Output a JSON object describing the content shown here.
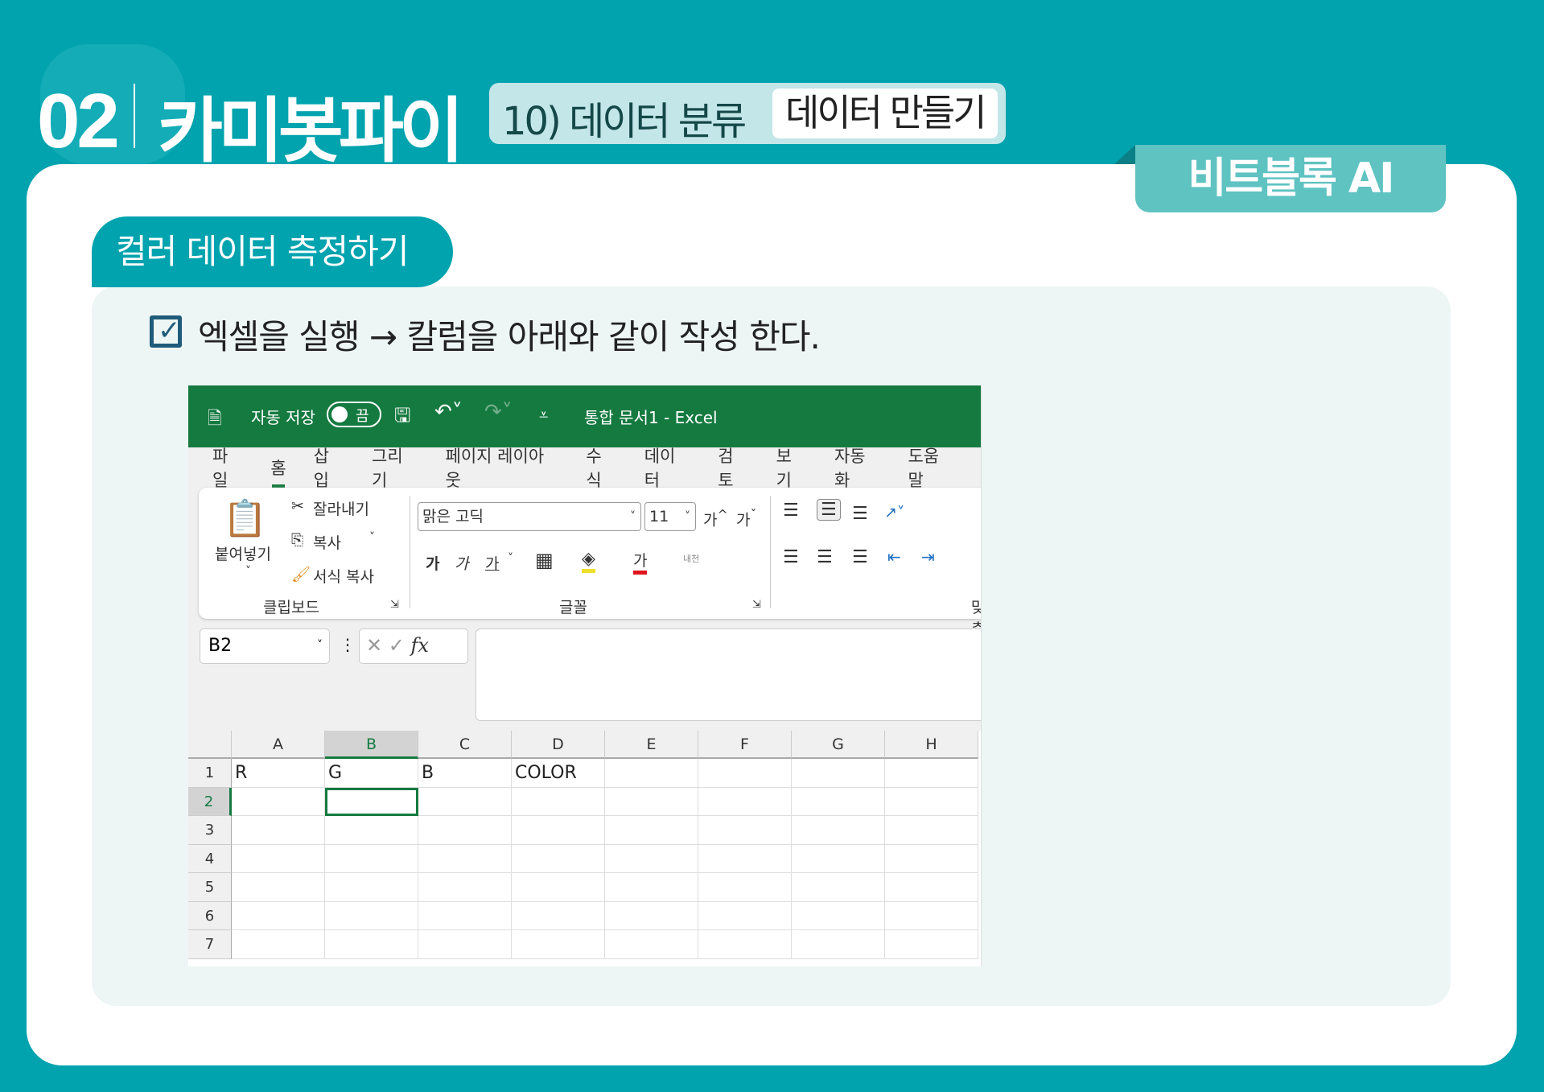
{
  "header": {
    "number": "02",
    "title": "카미봇파이",
    "subtitle": "10) 데이터 분류",
    "subtitle_tag": "데이터 만들기",
    "brand_tab": "비트블록 AI"
  },
  "section": {
    "title": "컬러 데이터 측정하기",
    "instruction": "엑셀을 실행 → 칼럼을 아래와 같이 작성 한다."
  },
  "excel": {
    "autosave_label": "자동 저장",
    "autosave_state": "끔",
    "window_title": "통합 문서1  -  Excel",
    "tabs": [
      "파일",
      "홈",
      "삽입",
      "그리기",
      "페이지 레이아웃",
      "수식",
      "데이터",
      "검토",
      "보기",
      "자동화",
      "도움말"
    ],
    "active_tab": "홈",
    "clipboard": {
      "paste": "붙여넣기",
      "cut": "잘라내기",
      "copy": "복사",
      "format_painter": "서식 복사",
      "group": "클립보드"
    },
    "font": {
      "name": "맑은 고딕",
      "size": "11",
      "grow": "가",
      "shrink": "가",
      "bold": "가",
      "italic": "가",
      "underline": "가",
      "color_a": "가",
      "phonetic": "내천",
      "group": "글꼴"
    },
    "align_group": "맞춤",
    "name_box": "B2",
    "fx": "fx",
    "columns": [
      "A",
      "B",
      "C",
      "D",
      "E",
      "F",
      "G",
      "H"
    ],
    "rows": [
      "1",
      "2",
      "3",
      "4",
      "5",
      "6",
      "7"
    ],
    "cells": {
      "A1": "R",
      "B1": "G",
      "C1": "B",
      "D1": "COLOR"
    },
    "selected_cell": "B2"
  },
  "colors": {
    "teal": "#00A3AE",
    "excel_green": "#157A40",
    "panel": "#EEF6F5"
  }
}
